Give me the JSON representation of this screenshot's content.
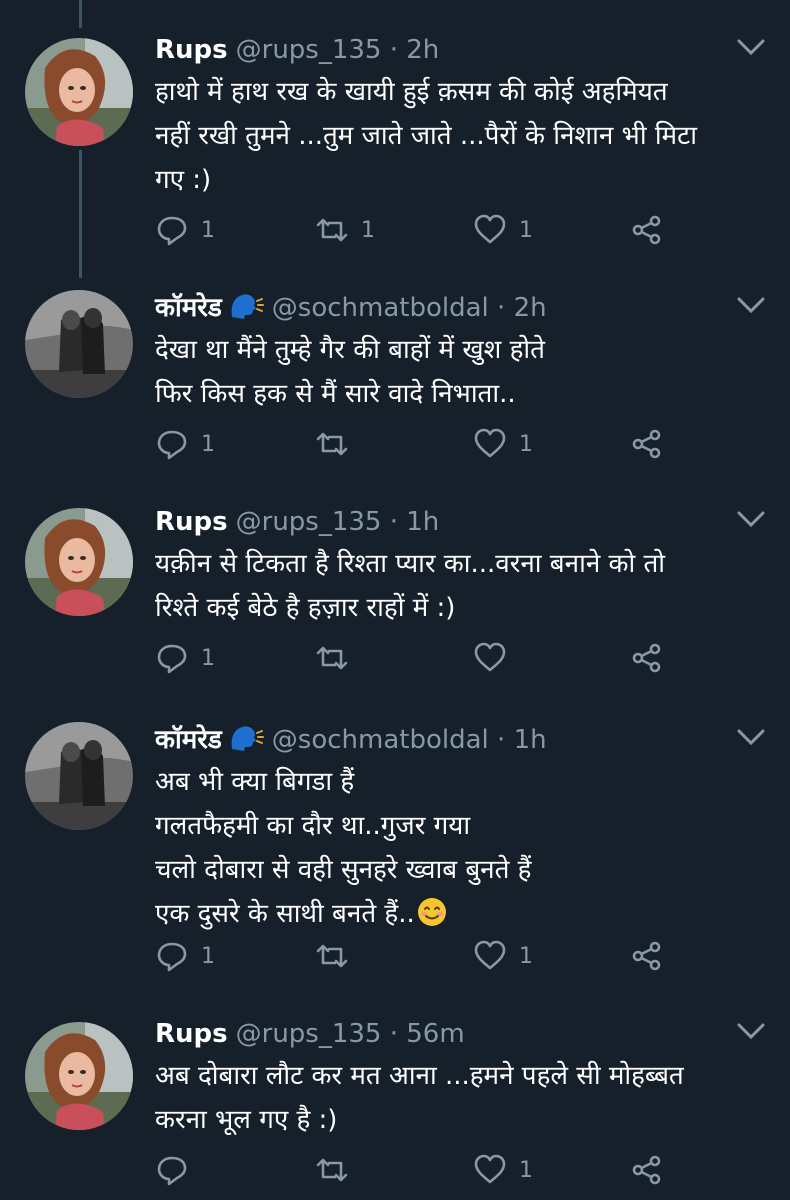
{
  "colors": {
    "background": "#15202b",
    "text": "#ffffff",
    "secondary": "#8899a6",
    "thread_line": "#3d5466"
  },
  "tweets": [
    {
      "name": "Rups",
      "handle": "@rups_135",
      "separator": "·",
      "time": "2h",
      "lines": [
        "हाथो में हाथ रख के खायी हुई क़सम की कोई अहमियत",
        "नहीं रखी तुमने ...तुम जाते जाते ...पैरों के निशान भी मिटा",
        "गए  :)"
      ],
      "replies": "1",
      "retweets": "1",
      "likes": "1",
      "avatar_icon": "woman-portrait",
      "has_emoji_badge": false,
      "has_smile_emoji": false
    },
    {
      "name": "कॉमरेड",
      "handle": "@sochmatboldal",
      "separator": "·",
      "time": "2h",
      "lines": [
        "देखा था मैंने तुम्हे गैर की बाहों में खुश होते",
        "फिर किस हक से मैं सारे वादे निभाता.."
      ],
      "replies": "1",
      "retweets": "",
      "likes": "1",
      "avatar_icon": "couple-bw-photo",
      "has_emoji_badge": true,
      "has_smile_emoji": false
    },
    {
      "name": "Rups",
      "handle": "@rups_135",
      "separator": "·",
      "time": "1h",
      "lines": [
        "यक़ीन से टिकता है रिश्ता प्यार का...वरना बनाने को तो",
        "रिश्ते कई बेठे है हज़ार राहों में :)"
      ],
      "replies": "1",
      "retweets": "",
      "likes": "",
      "avatar_icon": "woman-portrait",
      "has_emoji_badge": false,
      "has_smile_emoji": false
    },
    {
      "name": "कॉमरेड",
      "handle": "@sochmatboldal",
      "separator": "·",
      "time": "1h",
      "lines": [
        "अब भी क्या बिगडा हैं",
        "गलतफैहमी का दौर था..गुजर गया",
        "चलो दोबारा से वही सुनहरे ख्वाब बुनते हैं",
        "एक दुसरे के साथी बनते हैं.."
      ],
      "replies": "1",
      "retweets": "",
      "likes": "1",
      "avatar_icon": "couple-bw-photo",
      "has_emoji_badge": true,
      "has_smile_emoji": true
    },
    {
      "name": "Rups",
      "handle": "@rups_135",
      "separator": "·",
      "time": "56m",
      "lines": [
        "अब दोबारा लौट कर मत आना ...हमने पहले सी मोहब्बत",
        "करना भूल गए है :)"
      ],
      "replies": "",
      "retweets": "",
      "likes": "1",
      "avatar_icon": "woman-portrait",
      "has_emoji_badge": false,
      "has_smile_emoji": false
    }
  ]
}
